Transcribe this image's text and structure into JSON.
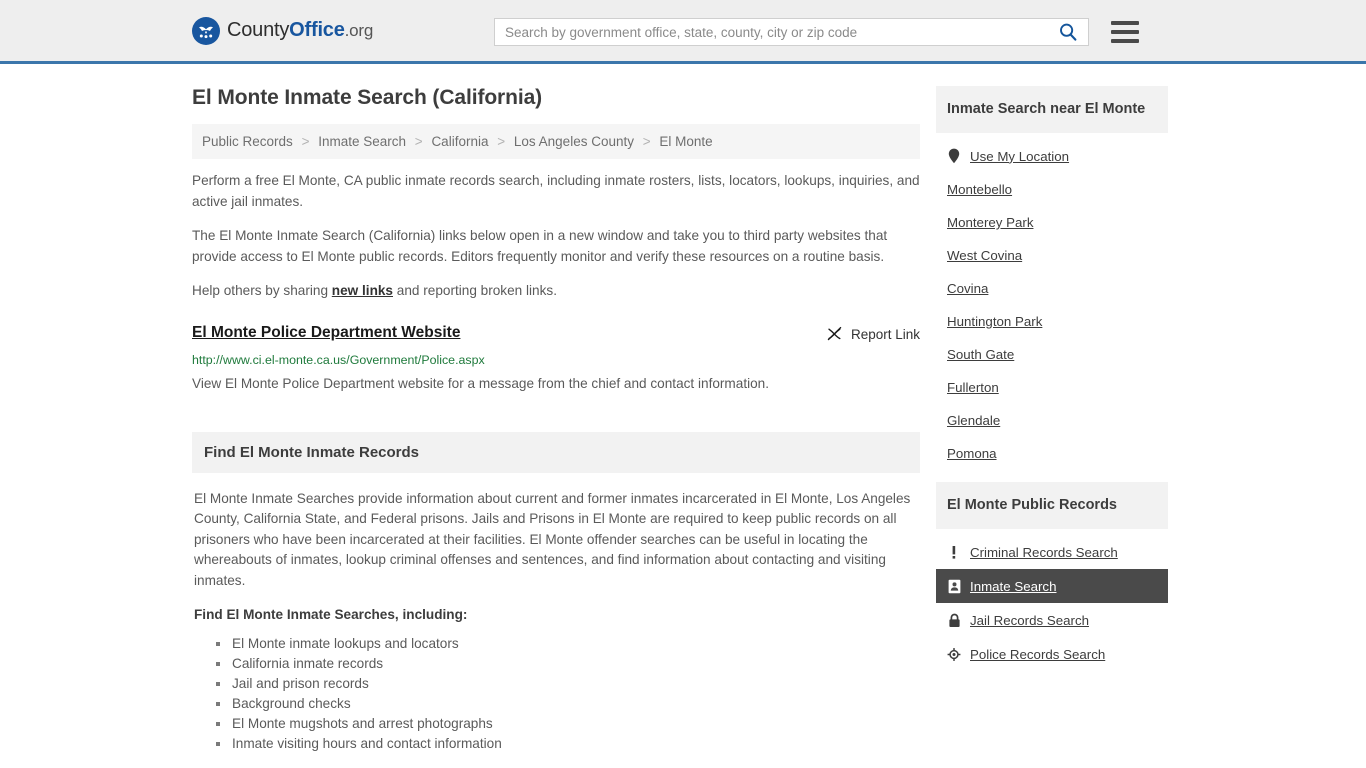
{
  "header": {
    "logo": {
      "text_1": "County",
      "text_2": "Office",
      "text_3": ".org",
      "icon": "eagle-stars-logo"
    },
    "search": {
      "placeholder": "Search by government office, state, county, city or zip code",
      "value": "",
      "icon": "search-icon"
    },
    "menu_icon": "hamburger-menu-icon",
    "accent_color": "#3b76ab",
    "background_color": "#eeeeee"
  },
  "main": {
    "title": "El Monte Inmate Search (California)",
    "breadcrumb": [
      {
        "label": "Public Records"
      },
      {
        "label": "Inmate Search"
      },
      {
        "label": "California"
      },
      {
        "label": "Los Angeles County"
      },
      {
        "label": "El Monte"
      }
    ],
    "breadcrumb_separator": ">",
    "intro_paragraphs": [
      "Perform a free El Monte, CA public inmate records search, including inmate rosters, lists, locators, lookups, inquiries, and active jail inmates.",
      "The El Monte Inmate Search (California) links below open in a new window and take you to third party websites that provide access to El Monte public records. Editors frequently monitor and verify these resources on a routine basis."
    ],
    "help_text_before": "Help others by sharing ",
    "help_link": "new links",
    "help_text_after": " and reporting broken links.",
    "result": {
      "title": "El Monte Police Department Website",
      "report_label": "Report Link",
      "report_icon": "broken-link-icon",
      "url": "http://www.ci.el-monte.ca.us/Government/Police.aspx",
      "url_color": "#1f7a3c",
      "description": "View El Monte Police Department website for a message from the chief and contact information."
    },
    "section": {
      "heading": "Find El Monte Inmate Records",
      "paragraph": "El Monte Inmate Searches provide information about current and former inmates incarcerated in El Monte, Los Angeles County, California State, and Federal prisons. Jails and Prisons in El Monte are required to keep public records on all prisoners who have been incarcerated at their facilities. El Monte offender searches can be useful in locating the whereabouts of inmates, lookup criminal offenses and sentences, and find information about contacting and visiting inmates.",
      "sub_heading": "Find El Monte Inmate Searches, including:",
      "list": [
        "El Monte inmate lookups and locators",
        "California inmate records",
        "Jail and prison records",
        "Background checks",
        "El Monte mugshots and arrest photographs",
        "Inmate visiting hours and contact information"
      ]
    }
  },
  "sidebar": {
    "nearby": {
      "heading": "Inmate Search near El Monte",
      "items": [
        {
          "label": "Use My Location",
          "icon": "map-pin-icon"
        },
        {
          "label": "Montebello",
          "icon": ""
        },
        {
          "label": "Monterey Park",
          "icon": ""
        },
        {
          "label": "West Covina",
          "icon": ""
        },
        {
          "label": "Covina",
          "icon": ""
        },
        {
          "label": "Huntington Park",
          "icon": ""
        },
        {
          "label": "South Gate",
          "icon": ""
        },
        {
          "label": "Fullerton",
          "icon": ""
        },
        {
          "label": "Glendale",
          "icon": ""
        },
        {
          "label": "Pomona",
          "icon": ""
        }
      ]
    },
    "public_records": {
      "heading": "El Monte Public Records",
      "items": [
        {
          "label": "Criminal Records Search",
          "icon": "exclamation-icon",
          "active": false
        },
        {
          "label": "Inmate Search",
          "icon": "id-card-icon",
          "active": true
        },
        {
          "label": "Jail Records Search",
          "icon": "padlock-icon",
          "active": false
        },
        {
          "label": "Police Records Search",
          "icon": "target-icon",
          "active": false
        }
      ],
      "active_background": "#4a4a4a"
    }
  }
}
